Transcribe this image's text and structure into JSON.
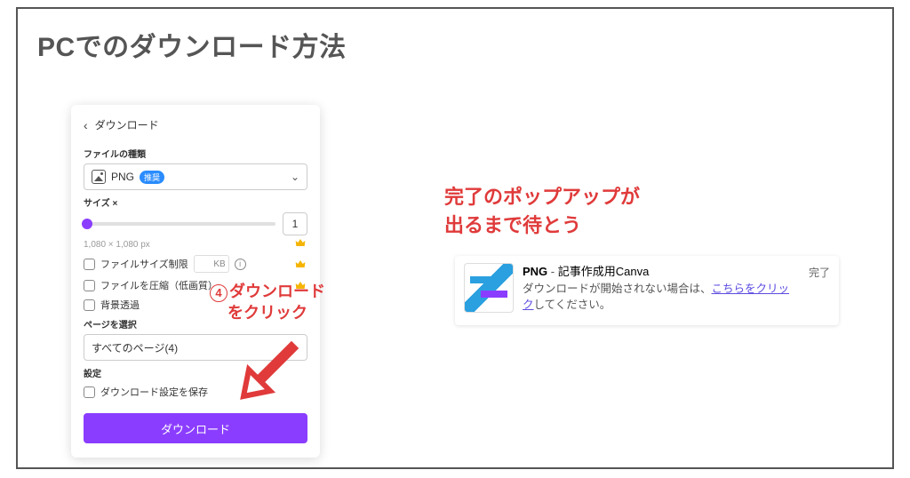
{
  "page": {
    "title": "PCでのダウンロード方法"
  },
  "panel": {
    "header": "ダウンロード",
    "file_type_label": "ファイルの種類",
    "file_type_value": "PNG",
    "file_type_badge": "推奨",
    "size_label": "サイズ ×",
    "size_value": "1",
    "dimensions": "1,080 × 1,080 px",
    "opts": {
      "file_size_limit": "ファイルサイズ制限",
      "kb_unit": "KB",
      "compress": "ファイルを圧縮（低画質）",
      "transparent_bg": "背景透過"
    },
    "pages_label": "ページを選択",
    "pages_value": "すべてのページ(4)",
    "settings_label": "設定",
    "save_settings": "ダウンロード設定を保存",
    "download_button": "ダウンロード"
  },
  "annot": {
    "step_num": "4",
    "step_line1": "ダウンロード",
    "step_line2": "をクリック",
    "wait_line1": "完了のポップアップが",
    "wait_line2": "出るまで待とう"
  },
  "popup": {
    "format": "PNG",
    "separator": " - ",
    "title_rest": "記事作成用Canva",
    "desc_prefix": "ダウンロードが開始されない場合は、",
    "link_text": "こちらをクリック",
    "desc_suffix": "してください。",
    "status": "完了"
  }
}
